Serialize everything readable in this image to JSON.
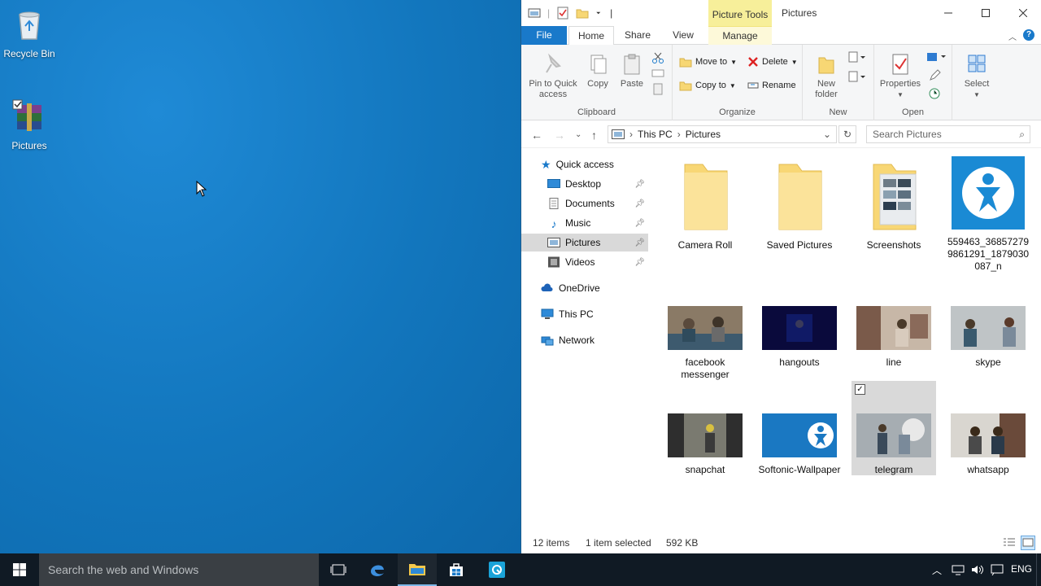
{
  "desktop": {
    "icons": [
      {
        "label": "Recycle Bin",
        "icon": "recycle-bin-icon"
      },
      {
        "label": "Pictures",
        "icon": "winrar-archive-icon"
      }
    ]
  },
  "window": {
    "title": "Pictures",
    "contextual_tab_group": "Picture Tools",
    "tabs": [
      "File",
      "Home",
      "Share",
      "View",
      "Manage"
    ]
  },
  "ribbon": {
    "clipboard": {
      "name": "Clipboard",
      "pin": "Pin to Quick access",
      "copy": "Copy",
      "paste": "Paste"
    },
    "organize": {
      "name": "Organize",
      "move_to": "Move to",
      "copy_to": "Copy to",
      "delete": "Delete",
      "rename": "Rename"
    },
    "new": {
      "name": "New",
      "new_folder": "New folder"
    },
    "open": {
      "name": "Open",
      "properties": "Properties"
    },
    "select": {
      "label": "Select"
    }
  },
  "address": {
    "crumbs": [
      "This PC",
      "Pictures"
    ],
    "search_placeholder": "Search Pictures"
  },
  "nav": {
    "quick_access": "Quick access",
    "pinned": [
      "Desktop",
      "Documents",
      "Music",
      "Pictures",
      "Videos"
    ],
    "onedrive": "OneDrive",
    "this_pc": "This PC",
    "network": "Network"
  },
  "items": [
    {
      "name": "Camera Roll",
      "kind": "folder"
    },
    {
      "name": "Saved Pictures",
      "kind": "folder"
    },
    {
      "name": "Screenshots",
      "kind": "folder"
    },
    {
      "name": "559463_368572799861291_1879030087_n",
      "kind": "image"
    },
    {
      "name": "facebook messenger",
      "kind": "image"
    },
    {
      "name": "hangouts",
      "kind": "image"
    },
    {
      "name": "line",
      "kind": "image"
    },
    {
      "name": "skype",
      "kind": "image"
    },
    {
      "name": "snapchat",
      "kind": "image"
    },
    {
      "name": "Softonic-Wallpaper",
      "kind": "image"
    },
    {
      "name": "telegram",
      "kind": "image"
    },
    {
      "name": "whatsapp",
      "kind": "image"
    }
  ],
  "status": {
    "count": "12 items",
    "selection": "1 item selected",
    "size": "592 KB"
  },
  "taskbar": {
    "search_placeholder": "Search the web and Windows",
    "language": "ENG"
  },
  "colors": {
    "desktop": "#1276bd",
    "accent": "#1979ca",
    "picture_tools": "#f7ef9a",
    "taskbar": "#101a24"
  }
}
